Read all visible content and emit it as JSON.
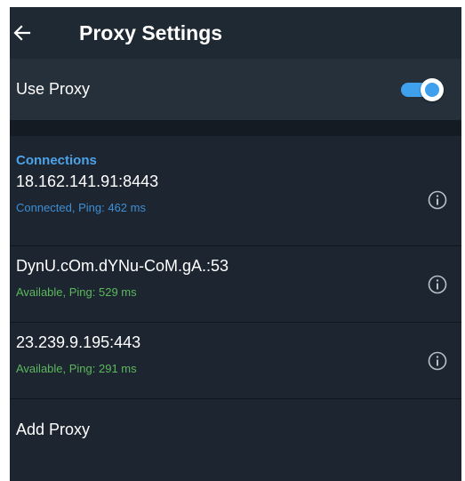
{
  "header": {
    "title": "Proxy Settings",
    "back_icon": "arrow-left-icon"
  },
  "use_proxy": {
    "label": "Use Proxy",
    "enabled": true
  },
  "connections": {
    "header": "Connections",
    "items": [
      {
        "address": "18.162.141.91:8443",
        "status": "Connected, Ping: 462 ms",
        "status_color": "#3f8fd6",
        "icon": "info-icon"
      },
      {
        "address": "DynU.cOm.dYNu-CoM.gA.:53",
        "status": "Available, Ping: 529 ms",
        "status_color": "#5cb85c",
        "icon": "info-icon"
      },
      {
        "address": "23.239.9.195:443",
        "status": "Available, Ping: 291 ms",
        "status_color": "#5cb85c",
        "icon": "info-icon"
      }
    ]
  },
  "add_proxy": {
    "label": "Add Proxy"
  },
  "colors": {
    "background": "#1c2530",
    "accent": "#3fa0ee",
    "section_header": "#4da3e8",
    "connected": "#3f8fd6",
    "available": "#5cb85c"
  }
}
